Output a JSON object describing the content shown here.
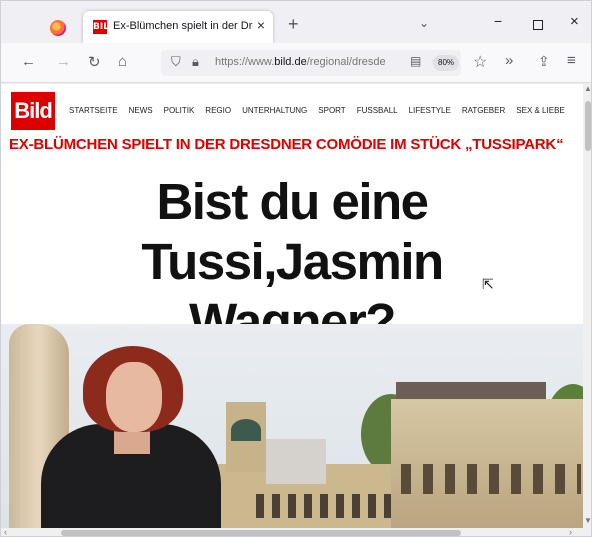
{
  "browser": {
    "tab_title": "Ex-Blümchen spielt in der Dresd",
    "tab_favicon_text": "BILD",
    "tab_close": "×",
    "newtab": "+",
    "tabs_menu": "⌄",
    "win_min": "−",
    "win_close": "×",
    "nav_back": "←",
    "nav_forward": "→",
    "nav_reload": "↻",
    "nav_home": "⌂",
    "url_prefix": "https://www.",
    "url_domain": "bild.de",
    "url_path": "/regional/dresde",
    "zoom": "80%",
    "more": "»",
    "menu": "≡"
  },
  "site": {
    "logo_text": "Bild",
    "brand_color": "#dd0000",
    "nav_items": [
      "STARTSEITE",
      "NEWS",
      "POLITIK",
      "REGIO",
      "UNTERHALTUNG",
      "SPORT",
      "FUSSBALL",
      "LIFESTYLE",
      "RATGEBER",
      "SEX & LIEBE"
    ]
  },
  "article": {
    "kicker": "EX-BLÜMCHEN SPIELT IN DER DRESDNER COMÖDIE IM STÜCK „TUSSIPARK“",
    "headline_line1": "Bist du eine Tussi,Jasmin",
    "headline_line2": "Wagner?"
  }
}
